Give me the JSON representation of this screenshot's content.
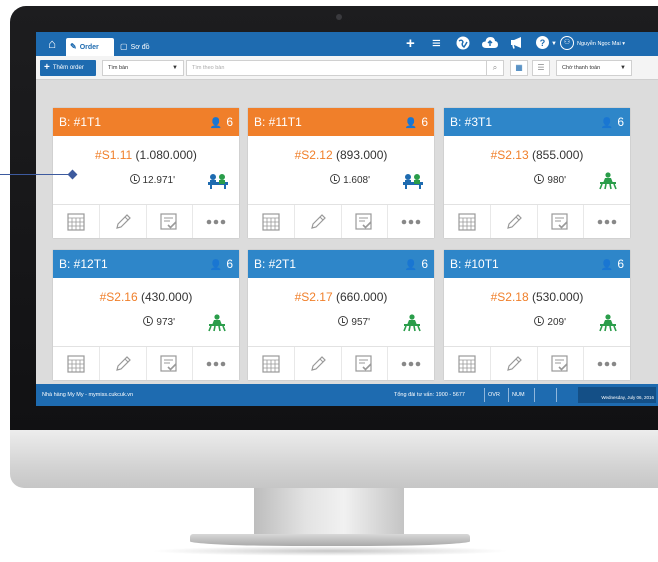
{
  "colors": {
    "brand": "#1e6bb0",
    "serving": "#f07f2a",
    "empty": "#2e86c9"
  },
  "topbar": {
    "tabs": [
      {
        "label": "Order",
        "icon": "edit-icon",
        "active": true
      },
      {
        "label": "Sơ đồ",
        "icon": "map-icon",
        "active": false
      }
    ],
    "user_name": "Nguyễn Ngọc Mai"
  },
  "toolbar": {
    "add_label": "Thêm order",
    "table_select": "Tìm bàn",
    "search_placeholder": "Tìm theo bàn",
    "status_select": "Chờ thanh toán"
  },
  "cards": [
    {
      "table": "B: #1T1",
      "guests": "6",
      "order_code": "#S1.11",
      "amount": "(1.080.000)",
      "time": "12.971'",
      "status": "serving"
    },
    {
      "table": "B: #11T1",
      "guests": "6",
      "order_code": "#S2.12",
      "amount": "(893.000)",
      "time": "1.608'",
      "status": "serving"
    },
    {
      "table": "B: #3T1",
      "guests": "6",
      "order_code": "#S2.13",
      "amount": "(855.000)",
      "time": "980'",
      "status": "waiting"
    },
    {
      "table": "B: #12T1",
      "guests": "6",
      "order_code": "#S2.16",
      "amount": "(430.000)",
      "time": "973'",
      "status": "waiting"
    },
    {
      "table": "B: #2T1",
      "guests": "6",
      "order_code": "#S2.17",
      "amount": "(660.000)",
      "time": "957'",
      "status": "waiting"
    },
    {
      "table": "B: #10T1",
      "guests": "6",
      "order_code": "#S2.18",
      "amount": "(530.000)",
      "time": "209'",
      "status": "waiting"
    }
  ],
  "statusbar": {
    "restaurant": "Nhà hàng My My - mymiss.cukcuk.vn",
    "hotline": "Tổng đài tư vấn: 1900 - 5677",
    "ovr": "OVR",
    "num": "NUM",
    "date": "Wednesday, July 06, 2016"
  }
}
